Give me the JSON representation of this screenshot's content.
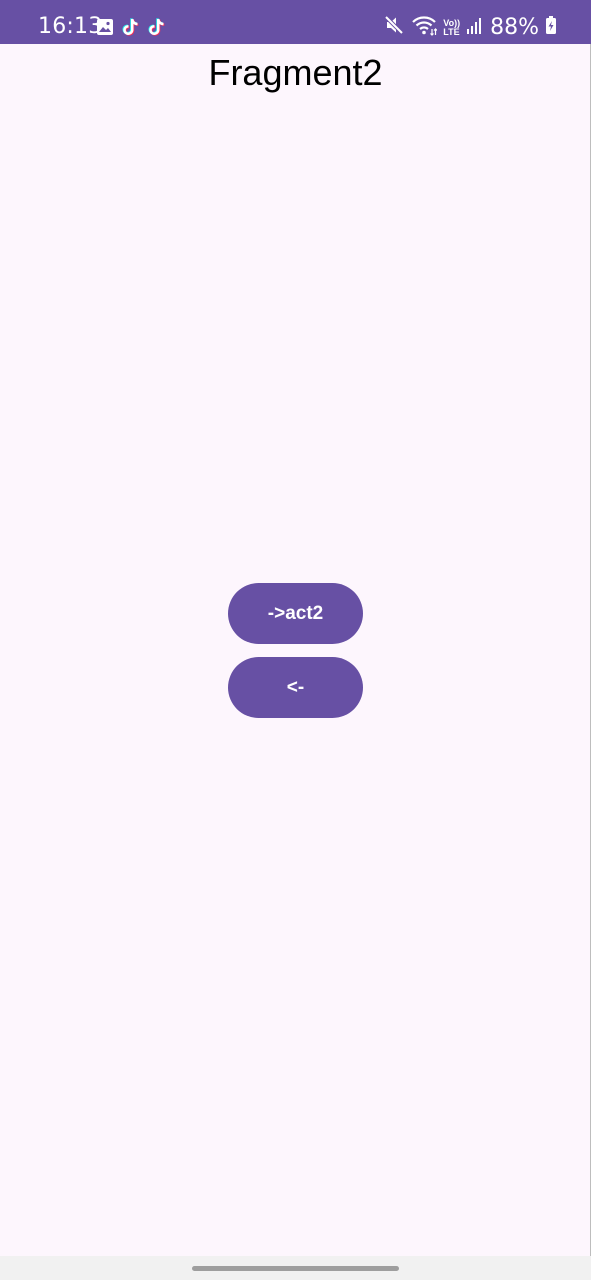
{
  "status_bar": {
    "time": "16:13",
    "battery": "88%",
    "left_icons": [
      "gallery-icon",
      "tiktok-icon",
      "tiktok-icon"
    ],
    "right_icons": [
      "mute-icon",
      "wifi-icon",
      "volte-icon",
      "signal-icon",
      "battery-icon"
    ],
    "volte_label_top": "Vo))",
    "volte_label_bottom": "LTE"
  },
  "colors": {
    "primary": "#6750a4",
    "background": "#fdf6fd",
    "on_primary": "#ffffff"
  },
  "page": {
    "title": "Fragment2"
  },
  "buttons": {
    "act2_label": "->act2",
    "back_label": "<-"
  }
}
